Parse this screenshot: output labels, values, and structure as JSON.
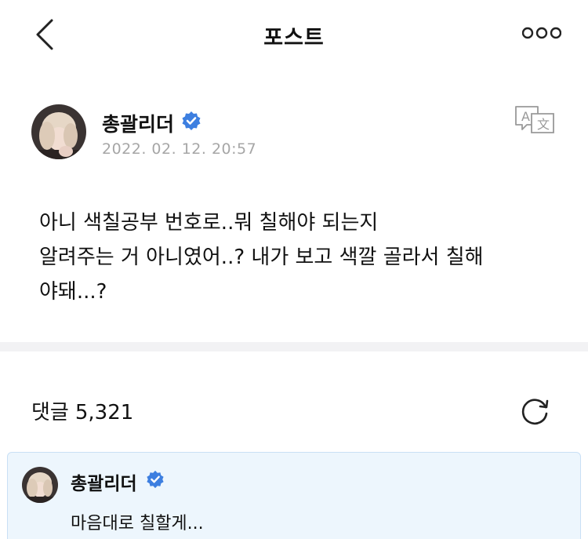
{
  "header": {
    "back_icon": "chevron-left-icon",
    "title": "포스트",
    "more_icon": "more-dots-icon"
  },
  "post": {
    "author_name": "총괄리더",
    "verified_icon": "verified-badge-icon",
    "date": "2022. 02. 12. 20:57",
    "translate_icon": "translate-icon",
    "body_lines": [
      "아니 색칠공부 번호로..뭐 칠해야 되는지",
      "알려주는 거 아니였어..? 내가 보고 색깔 골라서 칠해",
      "야돼...?"
    ]
  },
  "comments": {
    "label": "댓글",
    "count": "5,321",
    "refresh_icon": "refresh-icon"
  },
  "pinned_reply": {
    "author_name": "총괄리더",
    "text": "마음대로 칠할게..."
  },
  "colors": {
    "accent": "#3d7fe0",
    "date_gray": "#a6a6a6",
    "divider": "#f2f2f4",
    "reply_bg": "#edf6fd",
    "reply_border": "#c9e0f5"
  }
}
